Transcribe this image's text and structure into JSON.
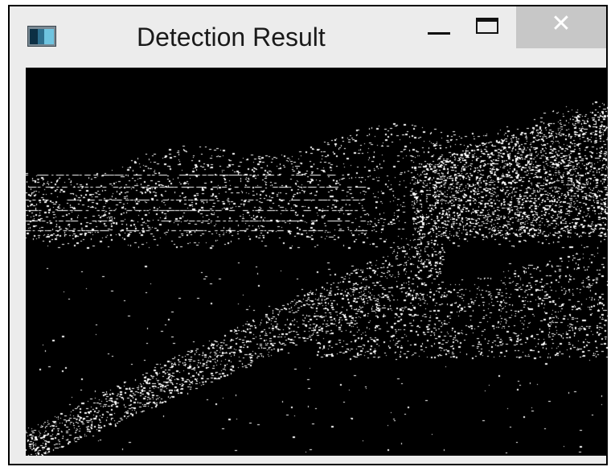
{
  "window": {
    "title": "Detection Result",
    "app_icon": "window-app-icon",
    "controls": {
      "minimize_icon": "minimize-icon",
      "maximize_icon": "maximize-icon",
      "close_icon": "close-icon",
      "close_glyph": "✕"
    }
  },
  "image": {
    "description_icon": "edge-detection-output-image",
    "background_color": "#000000",
    "foreground_color": "#ffffff"
  },
  "colors": {
    "titlebar": "#ececec",
    "close_button": "#c7c7c7",
    "border": "#000000"
  }
}
